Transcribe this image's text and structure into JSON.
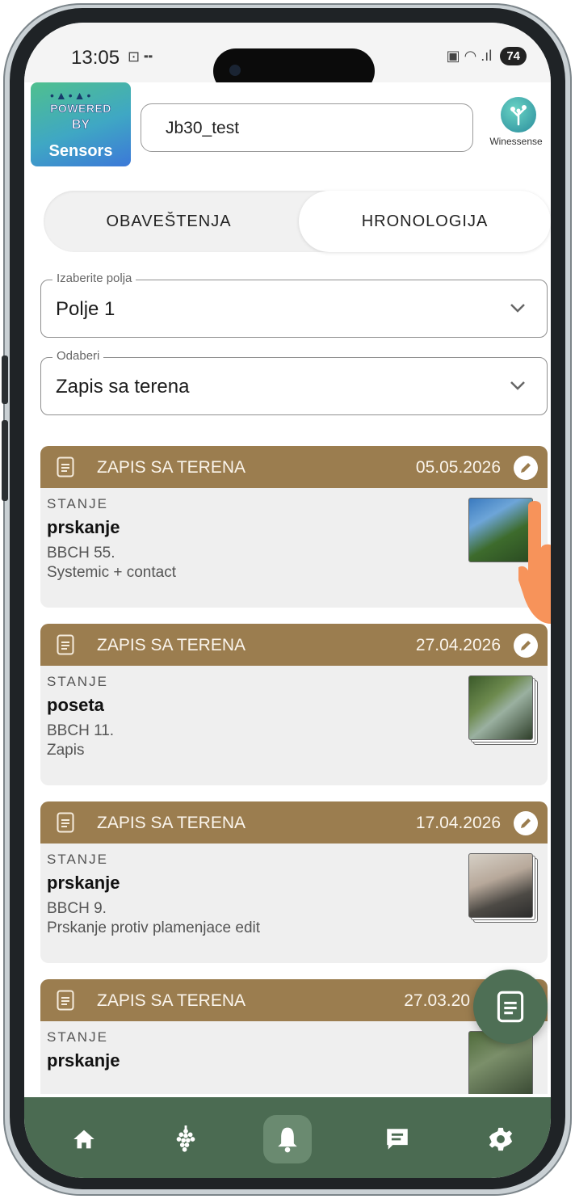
{
  "status_bar": {
    "time": "13:05",
    "left_icons": "⊡ ╍",
    "right_icons": "▣ ◠ .ıl",
    "battery": "74"
  },
  "header": {
    "logo": {
      "line1": "POWERED",
      "line2": "BY",
      "line3": "Sensors"
    },
    "device_name": "Jb30_test",
    "brand_label": "Winessense"
  },
  "tabs": [
    {
      "label": "OBAVEŠTENJA",
      "selected": false
    },
    {
      "label": "HRONOLOGIJA",
      "selected": true
    }
  ],
  "filters": {
    "field": {
      "legend": "Izaberite polja",
      "value": "Polje 1"
    },
    "type": {
      "legend": "Odaberi",
      "value": "Zapis sa terena"
    }
  },
  "colors": {
    "card_header": "#9b7d4f",
    "nav_background": "#4b6b52",
    "fab": "#4e6f55",
    "pointer_hand": "#f7935a"
  },
  "records": [
    {
      "type": "ZAPIS SA TERENA",
      "date": "05.05.2026",
      "status_label": "STANJE",
      "status_value": "prskanje",
      "bbch": "BBCH 55.",
      "note": "Systemic + contact",
      "stacked_photos": false
    },
    {
      "type": "ZAPIS SA TERENA",
      "date": "27.04.2026",
      "status_label": "STANJE",
      "status_value": "poseta",
      "bbch": "BBCH 11.",
      "note": "Zapis",
      "stacked_photos": true
    },
    {
      "type": "ZAPIS SA TERENA",
      "date": "17.04.2026",
      "status_label": "STANJE",
      "status_value": "prskanje",
      "bbch": "BBCH 9.",
      "note": "Prskanje protiv plamenjace edit",
      "stacked_photos": true
    },
    {
      "type": "ZAPIS SA TERENA",
      "date": "27.03.20",
      "status_label": "STANJE",
      "status_value": "prskanje",
      "bbch": "",
      "note": "",
      "stacked_photos": false
    }
  ],
  "bottom_nav": [
    {
      "icon": "home-icon",
      "active": false
    },
    {
      "icon": "grapes-icon",
      "active": false
    },
    {
      "icon": "bell-icon",
      "active": true
    },
    {
      "icon": "message-icon",
      "active": false
    },
    {
      "icon": "gear-icon",
      "active": false
    }
  ]
}
